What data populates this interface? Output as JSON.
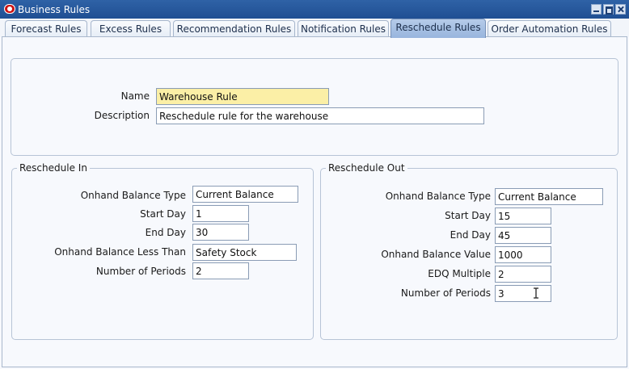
{
  "window": {
    "title": "Business Rules"
  },
  "tabs": [
    {
      "label": "Forecast Rules"
    },
    {
      "label": "Excess Rules"
    },
    {
      "label": "Recommendation Rules"
    },
    {
      "label": "Notification Rules"
    },
    {
      "label": "Reschedule Rules",
      "active": true
    },
    {
      "label": "Order Automation Rules"
    }
  ],
  "header": {
    "name_label": "Name",
    "name_value": "Warehouse Rule",
    "description_label": "Description",
    "description_value": "Reschedule rule for the warehouse"
  },
  "reschedule_in": {
    "title": "Reschedule In",
    "fields": [
      {
        "label": "Onhand Balance Type",
        "value": "Current Balance"
      },
      {
        "label": "Start Day",
        "value": "1"
      },
      {
        "label": "End Day",
        "value": "30"
      },
      {
        "label": "Onhand Balance Less Than",
        "value": "Safety Stock"
      },
      {
        "label": "Number of Periods",
        "value": "2"
      }
    ]
  },
  "reschedule_out": {
    "title": "Reschedule Out",
    "fields": [
      {
        "label": "Onhand Balance Type",
        "value": "Current Balance"
      },
      {
        "label": "Start Day",
        "value": "15"
      },
      {
        "label": "End Day",
        "value": "45"
      },
      {
        "label": "Onhand Balance Value",
        "value": "1000"
      },
      {
        "label": "EDQ Multiple",
        "value": "2"
      },
      {
        "label": "Number of Periods",
        "value": "3"
      }
    ]
  },
  "colors": {
    "title_bar": "#2f62a6",
    "active_tab": "#a9c1e4",
    "highlight_field": "#fbefa6"
  }
}
